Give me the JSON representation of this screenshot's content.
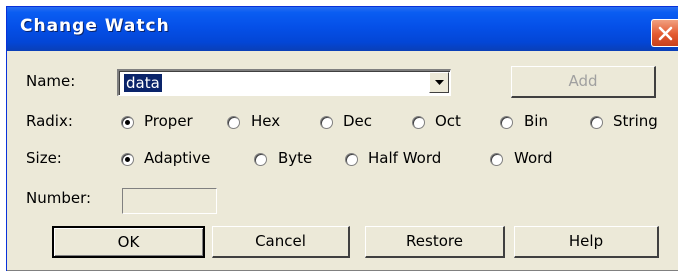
{
  "title": "Change Watch",
  "name": {
    "label": "Name:",
    "value": "data"
  },
  "add_button": "Add",
  "radix": {
    "label": "Radix:",
    "options": [
      {
        "label": "Proper",
        "selected": true
      },
      {
        "label": "Hex",
        "selected": false
      },
      {
        "label": "Dec",
        "selected": false
      },
      {
        "label": "Oct",
        "selected": false
      },
      {
        "label": "Bin",
        "selected": false
      },
      {
        "label": "String",
        "selected": false
      }
    ]
  },
  "size": {
    "label": "Size:",
    "options": [
      {
        "label": "Adaptive",
        "selected": true
      },
      {
        "label": "Byte",
        "selected": false
      },
      {
        "label": "Half Word",
        "selected": false
      },
      {
        "label": "Word",
        "selected": false
      }
    ]
  },
  "number": {
    "label": "Number:",
    "value": ""
  },
  "buttons": {
    "ok": "OK",
    "cancel": "Cancel",
    "restore": "Restore",
    "help": "Help"
  },
  "colors": {
    "titlebar": "#0550e8",
    "dialog_bg": "#ece9d8",
    "selection": "#0a246a",
    "close": "#e35a30"
  },
  "icons": {
    "close": "close-icon",
    "dropdown": "chevron-down-icon"
  }
}
